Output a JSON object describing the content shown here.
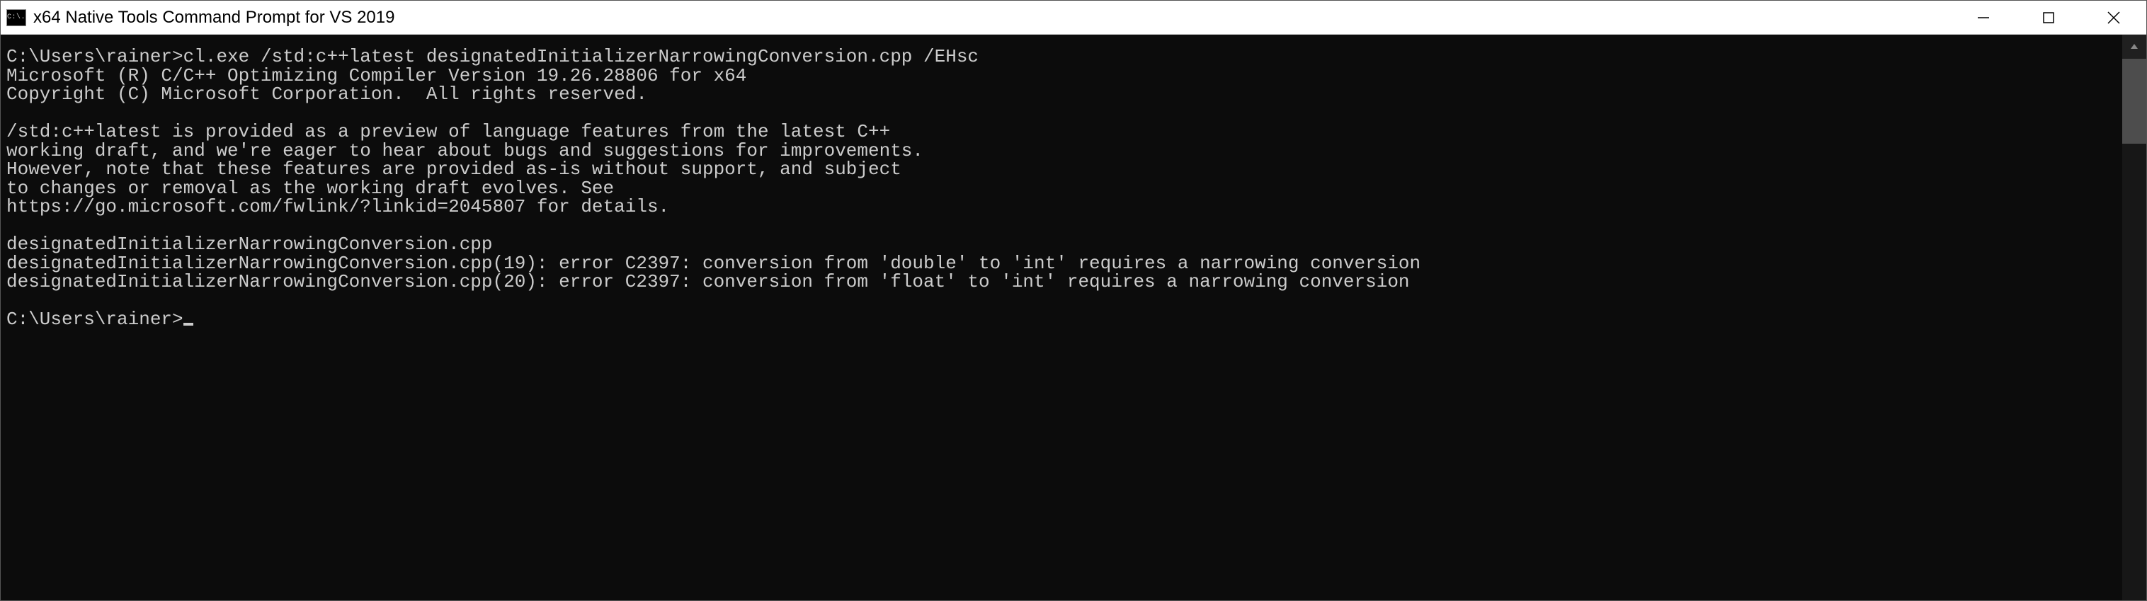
{
  "window": {
    "title": "x64 Native Tools Command Prompt for VS 2019",
    "icon_text": "C:\\."
  },
  "terminal": {
    "prompt1_path": "C:\\Users\\rainer>",
    "command": "cl.exe /std:c++latest designatedInitializerNarrowingConversion.cpp /EHsc",
    "compiler_banner": "Microsoft (R) C/C++ Optimizing Compiler Version 19.26.28806 for x64",
    "copyright": "Copyright (C) Microsoft Corporation.  All rights reserved.",
    "preview_l1": "/std:c++latest is provided as a preview of language features from the latest C++",
    "preview_l2": "working draft, and we're eager to hear about bugs and suggestions for improvements.",
    "preview_l3": "However, note that these features are provided as-is without support, and subject",
    "preview_l4": "to changes or removal as the working draft evolves. See",
    "preview_l5": "https://go.microsoft.com/fwlink/?linkid=2045807 for details.",
    "file_line": "designatedInitializerNarrowingConversion.cpp",
    "error1": "designatedInitializerNarrowingConversion.cpp(19): error C2397: conversion from 'double' to 'int' requires a narrowing conversion",
    "error2": "designatedInitializerNarrowingConversion.cpp(20): error C2397: conversion from 'float' to 'int' requires a narrowing conversion",
    "prompt2_path": "C:\\Users\\rainer>"
  }
}
